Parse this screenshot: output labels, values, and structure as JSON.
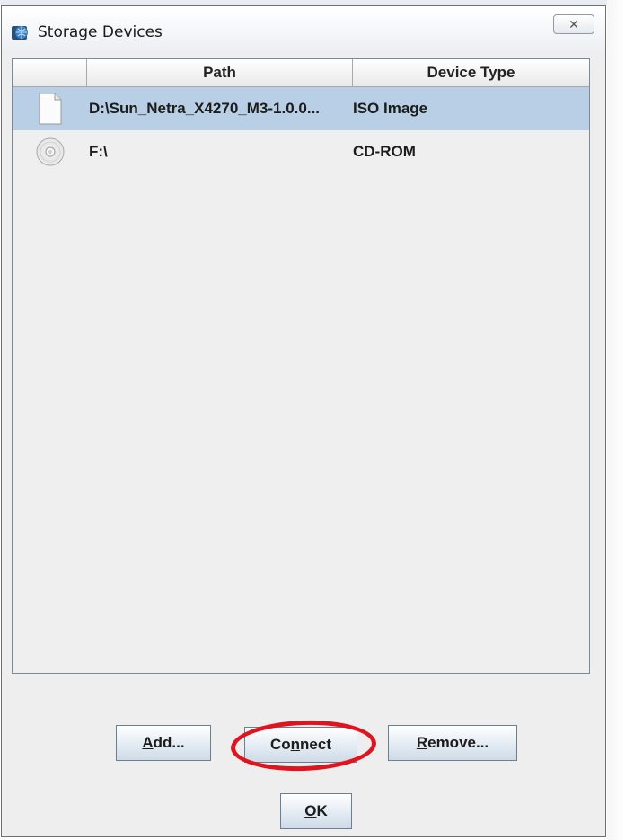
{
  "window": {
    "title": "Storage Devices",
    "close_glyph": "✕"
  },
  "table": {
    "columns": {
      "icon": "",
      "path": "Path",
      "type": "Device Type"
    },
    "rows": [
      {
        "icon": "document-icon",
        "path": "D:\\Sun_Netra_X4270_M3-1.0.0...",
        "type": "ISO Image",
        "selected": true
      },
      {
        "icon": "cd-disc-icon",
        "path": "F:\\",
        "type": "CD-ROM",
        "selected": false
      }
    ]
  },
  "buttons": {
    "add": {
      "prefix": "",
      "mnemonic": "A",
      "suffix": "dd..."
    },
    "connect": {
      "prefix": "Co",
      "mnemonic": "n",
      "suffix": "nect"
    },
    "remove": {
      "prefix": "",
      "mnemonic": "R",
      "suffix": "emove..."
    },
    "ok": {
      "prefix": "",
      "mnemonic": "O",
      "suffix": "K"
    }
  },
  "colors": {
    "selection": "#b8cfe5",
    "highlight_ring": "#e0141e"
  }
}
